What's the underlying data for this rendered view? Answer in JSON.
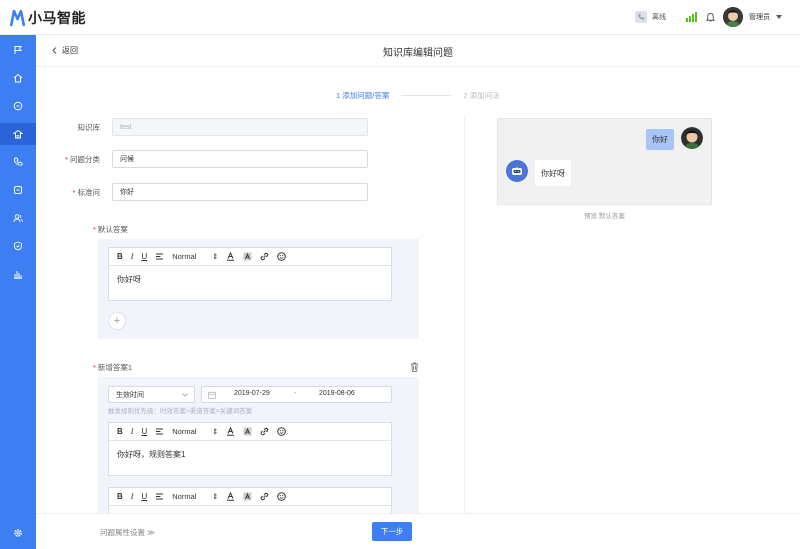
{
  "app": {
    "brand": "小马智能"
  },
  "header": {
    "status_label": "离线",
    "username": "管理员"
  },
  "sidebar": {
    "items": [
      {
        "icon": "flag-icon"
      },
      {
        "icon": "home-icon"
      },
      {
        "icon": "clock-icon"
      },
      {
        "icon": "knowledge-icon",
        "active": true
      },
      {
        "icon": "phone-icon"
      },
      {
        "icon": "message-icon"
      },
      {
        "icon": "users-icon"
      },
      {
        "icon": "shield-icon"
      },
      {
        "icon": "bar-chart-icon"
      },
      {
        "icon": "settings-icon"
      }
    ]
  },
  "page": {
    "back_label": "返回",
    "title": "知识库编辑问题"
  },
  "steps": {
    "step1": "1 添加问题/答案",
    "step2": "2 添加问法"
  },
  "form": {
    "kb_label": "知识库",
    "kb_value": "test",
    "category_label": "问题分类",
    "category_value": "问候",
    "standard_q_label": "标准问",
    "standard_q_value": "你好"
  },
  "default_answer": {
    "label": "默认答案",
    "toolbar": {
      "bold": "B",
      "italic": "I",
      "underline": "U",
      "format": "Normal",
      "format_arrow": "⇕"
    },
    "content": "你好呀"
  },
  "new_answer": {
    "label": "新增答案1",
    "time_select": "生效时间",
    "date_start": "2019-07-29",
    "date_sep": "-",
    "date_end": "2019-08-06",
    "hint": "触发规则优先级：时效答案>渠道答案>关键词答案",
    "toolbar": {
      "bold": "B",
      "italic": "I",
      "underline": "U",
      "format": "Normal",
      "format_arrow": "⇕"
    },
    "content": "你好呀，规则答案1"
  },
  "preview": {
    "user_msg": "你好",
    "bot_msg": "你好呀",
    "caption": "预览 默认答案"
  },
  "footer": {
    "props_label": "问题属性设置 ≫",
    "next_label": "下一步"
  },
  "colors": {
    "primary": "#3d7ef2",
    "sidebar_active": "#2a64d8",
    "required": "#f5222d"
  }
}
